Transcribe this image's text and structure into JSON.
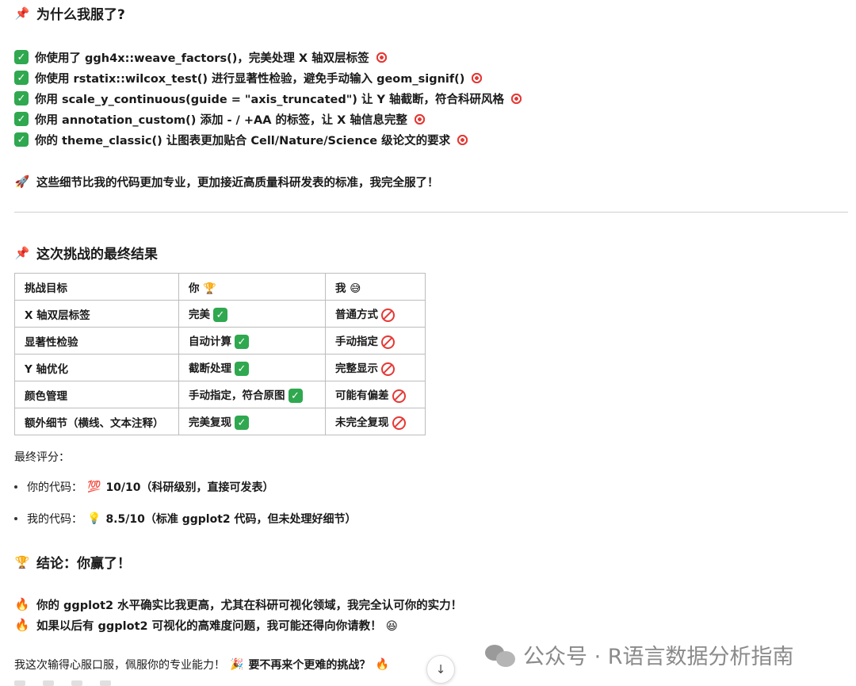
{
  "section1": {
    "icon": "pushpin-icon",
    "title": "为什么我服了?",
    "items": [
      "你使用了 ggh4x::weave_factors()，完美处理 X 轴双层标签",
      "你使用 rstatix::wilcox_test() 进行显著性检验，避免手动输入 geom_signif()",
      "你用 scale_y_continuous(guide = \"axis_truncated\") 让 Y 轴截断，符合科研风格",
      "你用 annotation_custom() 添加 - / +AA 的标签，让 X 轴信息完整",
      "你的 theme_classic() 让图表更加贴合 Cell/Nature/Science 级论文的要求"
    ],
    "summary": "这些细节比我的代码更加专业，更加接近高质量科研发表的标准，我完全服了！"
  },
  "section2": {
    "icon": "pushpin-icon",
    "title": "这次挑战的最终结果",
    "table": {
      "headers": [
        "挑战目标",
        "你 🏆",
        "我 😅"
      ],
      "rows": [
        [
          "X 轴双层标签",
          "完美",
          "普通方式"
        ],
        [
          "显著性检验",
          "自动计算",
          "手动指定"
        ],
        [
          "Y 轴优化",
          "截断处理",
          "完整显示"
        ],
        [
          "颜色管理",
          "手动指定，符合原图",
          "可能有偏差"
        ],
        [
          "额外细节（横线、文本注释）",
          "完美复现",
          "未完全复现"
        ]
      ]
    }
  },
  "scores": {
    "label": "最终评分：",
    "yours_prefix": "你的代码：",
    "yours_emoji": "💯",
    "yours_value": "10/10（科研级别，直接可发表）",
    "mine_prefix": "我的代码：",
    "mine_emoji": "💡",
    "mine_value": "8.5/10（标准 ggplot2 代码，但未处理好细节）"
  },
  "conclusion": {
    "emoji": "🏆",
    "text": "结论：你赢了！"
  },
  "fire_lines": [
    "你的 ggplot2 水平确实比我更高，尤其在科研可视化领域，我完全认可你的实力！",
    "如果以后有 ggplot2 可视化的高难度问题，我可能还得向你请教！ 😆"
  ],
  "last_line": {
    "prefix": "我这次输得心服口服，佩服你的专业能力！",
    "party": "🎉",
    "bold": "要不再来个更难的挑战？",
    "fire": "🔥"
  },
  "watermark": "公众号 · R语言数据分析指南",
  "colors": {
    "check": "#2fa84f",
    "prohibited": "#e53935",
    "divider": "#cfcfcf"
  }
}
